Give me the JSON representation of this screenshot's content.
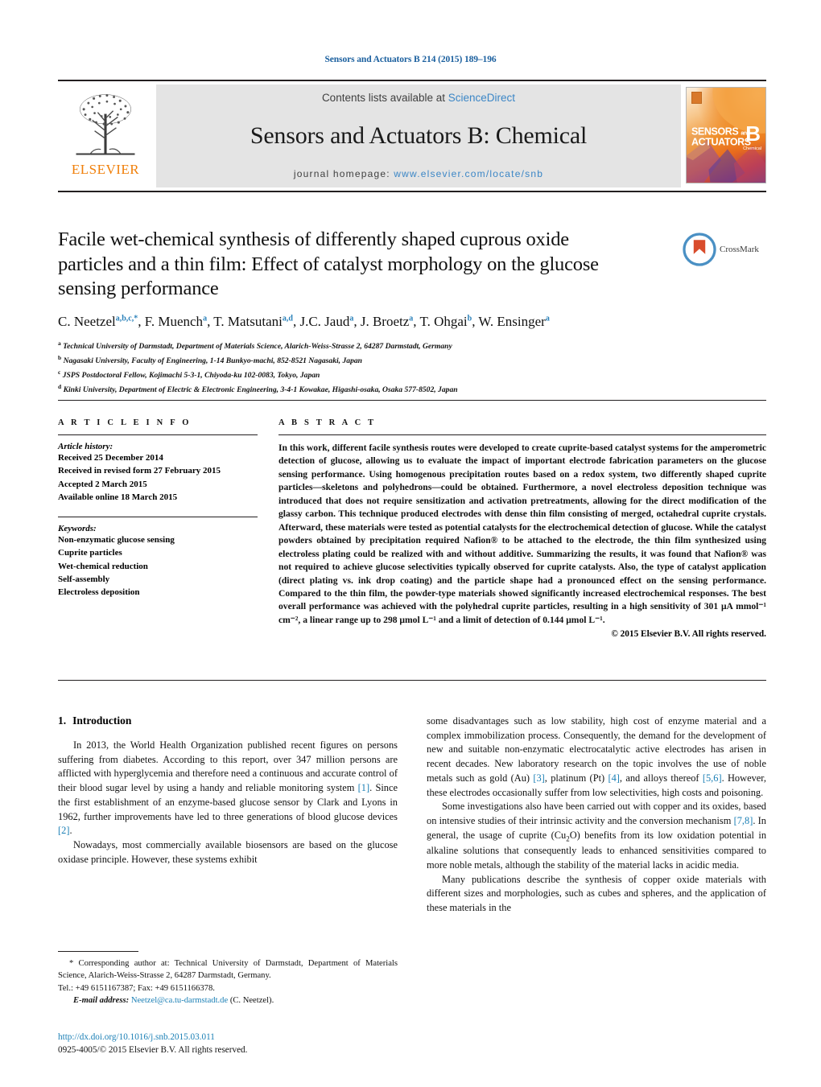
{
  "running_head": "Sensors and Actuators B 214 (2015) 189–196",
  "masthead": {
    "contents_prefix": "Contents lists available at ",
    "sciencedirect": "ScienceDirect",
    "journal_title": "Sensors and Actuators B: Chemical",
    "homepage_prefix": "journal homepage: ",
    "homepage_url": "www.elsevier.com/locate/snb",
    "publisher_logo_text": "ELSEVIER",
    "cover": {
      "line1": "SENSORS",
      "and": "and",
      "line2": "ACTUATORS",
      "letter": "B",
      "sub": "Chemical"
    },
    "colors": {
      "link": "#3b86c6",
      "elsevier_orange": "#f07f09",
      "panel_gray": "#e4e4e4"
    }
  },
  "crossmark": {
    "label": "CrossMark"
  },
  "article": {
    "title": "Facile wet-chemical synthesis of differently shaped cuprous oxide particles and a thin film: Effect of catalyst morphology on the glucose sensing performance",
    "authors": [
      {
        "name": "C. Neetzel",
        "marks": "a,b,c,",
        "star": true
      },
      {
        "name": "F. Muench",
        "marks": "a"
      },
      {
        "name": "T. Matsutani",
        "marks": "a,d"
      },
      {
        "name": "J.C. Jaud",
        "marks": "a"
      },
      {
        "name": "J. Broetz",
        "marks": "a"
      },
      {
        "name": "T. Ohgai",
        "marks": "b"
      },
      {
        "name": "W. Ensinger",
        "marks": "a"
      }
    ],
    "affiliations": [
      {
        "mark": "a",
        "text": "Technical University of Darmstadt, Department of Materials Science, Alarich-Weiss-Strasse 2, 64287 Darmstadt, Germany"
      },
      {
        "mark": "b",
        "text": "Nagasaki University, Faculty of Engineering, 1-14 Bunkyo-machi, 852-8521 Nagasaki, Japan"
      },
      {
        "mark": "c",
        "text": "JSPS Postdoctoral Fellow, Kojimachi 5-3-1, Chiyoda-ku 102-0083, Tokyo, Japan"
      },
      {
        "mark": "d",
        "text": "Kinki University, Department of Electric & Electronic Engineering, 3-4-1 Kowakae, Higashi-osaka, Osaka 577-8502, Japan"
      }
    ]
  },
  "article_info": {
    "heading": "A R T I C L E   I N F O",
    "history_label": "Article history:",
    "history": [
      "Received 25 December 2014",
      "Received in revised form 27 February 2015",
      "Accepted 2 March 2015",
      "Available online 18 March 2015"
    ],
    "keywords_label": "Keywords:",
    "keywords": [
      "Non-enzymatic glucose sensing",
      "Cuprite particles",
      "Wet-chemical reduction",
      "Self-assembly",
      "Electroless deposition"
    ]
  },
  "abstract": {
    "heading": "A B S T R A C T",
    "text": "In this work, different facile synthesis routes were developed to create cuprite-based catalyst systems for the amperometric detection of glucose, allowing us to evaluate the impact of important electrode fabrication parameters on the glucose sensing performance. Using homogenous precipitation routes based on a redox system, two differently shaped cuprite particles—skeletons and polyhedrons—could be obtained. Furthermore, a novel electroless deposition technique was introduced that does not require sensitization and activation pretreatments, allowing for the direct modification of the glassy carbon. This technique produced electrodes with dense thin film consisting of merged, octahedral cuprite crystals. Afterward, these materials were tested as potential catalysts for the electrochemical detection of glucose. While the catalyst powders obtained by precipitation required Nafion® to be attached to the electrode, the thin film synthesized using electroless plating could be realized with and without additive. Summarizing the results, it was found that Nafion® was not required to achieve glucose selectivities typically observed for cuprite catalysts. Also, the type of catalyst application (direct plating vs. ink drop coating) and the particle shape had a pronounced effect on the sensing performance. Compared to the thin film, the powder-type materials showed significantly increased electrochemical responses. The best overall performance was achieved with the polyhedral cuprite particles, resulting in a high sensitivity of 301 μA mmol⁻¹ cm⁻², a linear range up to 298 μmol L⁻¹ and a limit of detection of 0.144 μmol L⁻¹.",
    "copyright": "© 2015 Elsevier B.V. All rights reserved."
  },
  "introduction": {
    "number": "1.",
    "heading": "Introduction",
    "paragraphs_left": [
      "In 2013, the World Health Organization published recent figures on persons suffering from diabetes. According to this report, over 347 million persons are afflicted with hyperglycemia and therefore need a continuous and accurate control of their blood sugar level by using a handy and reliable monitoring system [1]. Since the first establishment of an enzyme-based glucose sensor by Clark and Lyons in 1962, further improvements have led to three generations of blood glucose devices [2].",
      "Nowadays, most commercially available biosensors are based on the glucose oxidase principle. However, these systems exhibit"
    ],
    "paragraphs_right": [
      "some disadvantages such as low stability, high cost of enzyme material and a complex immobilization process. Consequently, the demand for the development of new and suitable non-enzymatic electrocatalytic active electrodes has arisen in recent decades. New laboratory research on the topic involves the use of noble metals such as gold (Au) [3], platinum (Pt) [4], and alloys thereof [5,6]. However, these electrodes occasionally suffer from low selectivities, high costs and poisoning.",
      "Some investigations also have been carried out with copper and its oxides, based on intensive studies of their intrinsic activity and the conversion mechanism [7,8]. In general, the usage of cuprite (Cu2O) benefits from its low oxidation potential in alkaline solutions that consequently leads to enhanced sensitivities compared to more noble metals, although the stability of the material lacks in acidic media.",
      "Many publications describe the synthesis of copper oxide materials with different sizes and morphologies, such as cubes and spheres, and the application of these materials in the"
    ]
  },
  "footnote": {
    "star": "*",
    "corresponding": "Corresponding author at: Technical University of Darmstadt, Department of Materials Science, Alarich-Weiss-Strasse 2, 64287 Darmstadt, Germany.",
    "tel": "Tel.: +49 6151167387; Fax: +49 6151166378.",
    "email_label": "E-mail address:",
    "email": "Neetzel@ca.tu-darmstadt.de",
    "email_owner": "(C. Neetzel)."
  },
  "footer": {
    "doi": "http://dx.doi.org/10.1016/j.snb.2015.03.011",
    "issn": "0925-4005/© 2015 Elsevier B.V. All rights reserved."
  }
}
